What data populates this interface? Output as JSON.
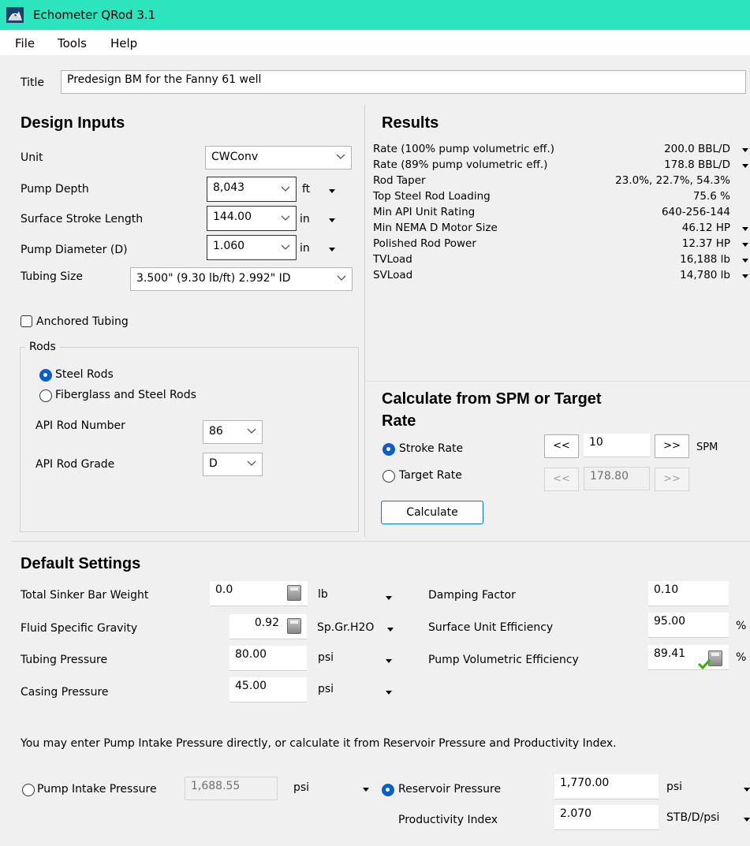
{
  "app": {
    "title": "Echometer QRod 3.1",
    "menu": [
      "File",
      "Tools",
      "Help"
    ]
  },
  "title_field": {
    "label": "Title",
    "value": "Predesign BM for the Fanny 61 well"
  },
  "design_inputs": {
    "heading": "Design Inputs",
    "unit": {
      "label": "Unit",
      "value": "CWConv"
    },
    "pump_depth": {
      "label": "Pump Depth",
      "value": "8,043",
      "unit": "ft"
    },
    "stroke_length": {
      "label": "Surface Stroke Length",
      "value": "144.00",
      "unit": "in"
    },
    "pump_diameter": {
      "label": "Pump Diameter (D)",
      "value": "1.060",
      "unit": "in"
    },
    "tubing_size": {
      "label": "Tubing Size",
      "value": "3.500\" (9.30 lb/ft) 2.992\" ID"
    },
    "anchored_tubing": {
      "label": "Anchored Tubing",
      "checked": false
    },
    "rods": {
      "legend": "Rods",
      "steel": "Steel Rods",
      "fiberglass": "Fiberglass and Steel Rods",
      "selected": "steel",
      "rod_number": {
        "label": "API Rod Number",
        "value": "86"
      },
      "rod_grade": {
        "label": "API Rod Grade",
        "value": "D"
      }
    }
  },
  "results": {
    "heading": "Results",
    "rows": [
      {
        "label": "Rate (100% pump volumetric eff.)",
        "value": "200.0 BBL/D",
        "dropdown": true
      },
      {
        "label": "Rate (89% pump volumetric eff.)",
        "value": "178.8 BBL/D",
        "dropdown": true
      },
      {
        "label": "Rod Taper",
        "value": "23.0%, 22.7%, 54.3%",
        "dropdown": false
      },
      {
        "label": "Top Steel Rod Loading",
        "value": "75.6 %",
        "dropdown": false
      },
      {
        "label": "Min API Unit Rating",
        "value": "640-256-144",
        "dropdown": false
      },
      {
        "label": "Min NEMA D Motor Size",
        "value": "46.12 HP",
        "dropdown": true
      },
      {
        "label": "Polished Rod Power",
        "value": "12.37 HP",
        "dropdown": true
      },
      {
        "label": "TVLoad",
        "value": "16,188 lb",
        "dropdown": true
      },
      {
        "label": "SVLoad",
        "value": "14,780 lb",
        "dropdown": true
      }
    ]
  },
  "calculate": {
    "heading_line1": "Calculate from SPM or Target",
    "heading_line2": "Rate",
    "stroke_rate": {
      "label": "Stroke Rate",
      "value": "10",
      "unit": "SPM",
      "selected": true
    },
    "target_rate": {
      "label": "Target Rate",
      "value": "178.80",
      "selected": false
    },
    "dec": "<<",
    "inc": ">>",
    "button": "Calculate"
  },
  "defaults": {
    "heading": "Default Settings",
    "sinker_bar": {
      "label": "Total Sinker Bar Weight",
      "value": "0.0",
      "unit": "lb"
    },
    "fluid_sg": {
      "label": "Fluid Specific Gravity",
      "value": "0.92",
      "unit": "Sp.Gr.H2O"
    },
    "tubing_pressure": {
      "label": "Tubing Pressure",
      "value": "80.00",
      "unit": "psi"
    },
    "casing_pressure": {
      "label": "Casing Pressure",
      "value": "45.00",
      "unit": "psi"
    },
    "damping": {
      "label": "Damping Factor",
      "value": "0.10"
    },
    "surface_eff": {
      "label": "Surface Unit Efficiency",
      "value": "95.00",
      "unit": "%"
    },
    "pump_vol_eff": {
      "label": "Pump Volumetric Efficiency",
      "value": "89.41",
      "unit": "%"
    }
  },
  "pip": {
    "note": "You may enter Pump Intake Pressure directly, or calculate it from Reservoir Pressure and Productivity Index.",
    "pump_intake": {
      "label": "Pump Intake Pressure",
      "value": "1,688.55",
      "unit": "psi",
      "selected": false
    },
    "reservoir": {
      "label": "Reservoir Pressure",
      "value": "1,770.00",
      "unit": "psi",
      "selected": true
    },
    "pi": {
      "label": "Productivity Index",
      "value": "2.070",
      "unit": "STB/D/psi"
    }
  }
}
